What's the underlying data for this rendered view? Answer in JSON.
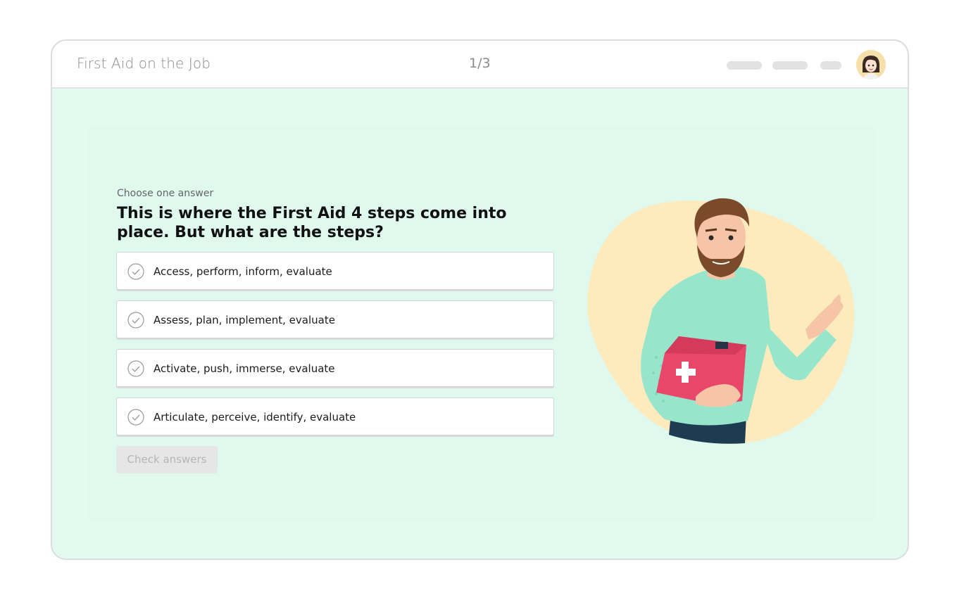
{
  "header": {
    "course_title": "First Aid on the Job",
    "progress": "1/3"
  },
  "question": {
    "instruction": "Choose one answer",
    "text": "This is where the First Aid 4 steps come into place. But what are the steps?",
    "options": [
      {
        "label": "Access, perform, inform, evaluate",
        "icon": "circle-check-icon"
      },
      {
        "label": "Assess, plan, implement, evaluate",
        "icon": "circle-check-icon"
      },
      {
        "label": "Activate, push, immerse, evaluate",
        "icon": "circle-check-icon"
      },
      {
        "label": "Articulate, perceive, identify, evaluate",
        "icon": "circle-check-icon"
      }
    ],
    "submit_label": "Check answers",
    "submit_enabled": false
  },
  "colors": {
    "background": "#e3faf1",
    "illustration_blob": "#fdebbd",
    "shirt": "#97e6cc",
    "kit": "#e8476a"
  }
}
